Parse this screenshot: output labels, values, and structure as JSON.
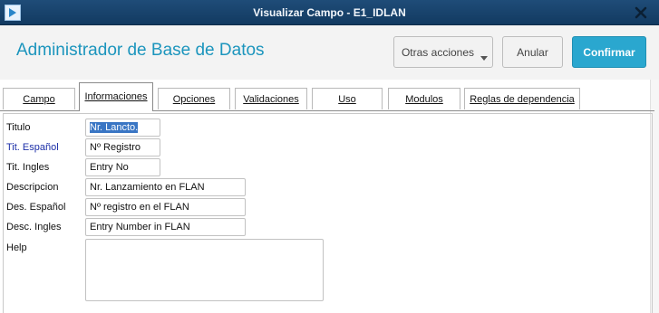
{
  "window": {
    "title": "Visualizar Campo - E1_IDLAN",
    "close_icon": "close-x-icon",
    "app_icon": "protheus-app-icon"
  },
  "header": {
    "title": "Administrador de Base de Datos",
    "buttons": {
      "more_actions": "Otras acciones",
      "cancel": "Anular",
      "confirm": "Confirmar"
    },
    "accent_color": "#2aa7cf"
  },
  "tabs": [
    {
      "label": "Campo",
      "active": false
    },
    {
      "label": "Informaciones",
      "active": true
    },
    {
      "label": "Opciones",
      "active": false
    },
    {
      "label": "Validaciones",
      "active": false
    },
    {
      "label": "Uso",
      "active": false
    },
    {
      "label": "Modulos",
      "active": false
    },
    {
      "label": "Reglas de dependencia",
      "active": false
    }
  ],
  "form": {
    "titulo": {
      "label": "Titulo",
      "value": "Nr. Lancto."
    },
    "tit_espanol": {
      "label": "Tit. Español",
      "value": "Nº Registro"
    },
    "tit_ingles": {
      "label": "Tit. Ingles",
      "value": "Entry No"
    },
    "descripcion": {
      "label": "Descripcion",
      "value": "Nr. Lanzamiento en FLAN"
    },
    "des_espanol": {
      "label": "Des. Español",
      "value": "Nº registro en el FLAN"
    },
    "desc_ingles": {
      "label": "Desc. Ingles",
      "value": "Entry Number in FLAN"
    },
    "help": {
      "label": "Help",
      "value": ""
    }
  }
}
